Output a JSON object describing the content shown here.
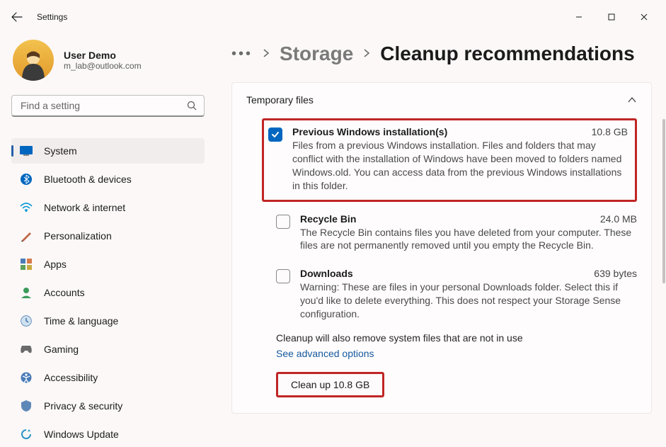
{
  "window": {
    "title": "Settings"
  },
  "user": {
    "name": "User Demo",
    "email": "m_lab@outlook.com"
  },
  "search": {
    "placeholder": "Find a setting"
  },
  "nav": [
    {
      "label": "System"
    },
    {
      "label": "Bluetooth & devices"
    },
    {
      "label": "Network & internet"
    },
    {
      "label": "Personalization"
    },
    {
      "label": "Apps"
    },
    {
      "label": "Accounts"
    },
    {
      "label": "Time & language"
    },
    {
      "label": "Gaming"
    },
    {
      "label": "Accessibility"
    },
    {
      "label": "Privacy & security"
    },
    {
      "label": "Windows Update"
    }
  ],
  "breadcrumb": {
    "parent": "Storage",
    "current": "Cleanup recommendations"
  },
  "panel": {
    "title": "Temporary files",
    "items": [
      {
        "title": "Previous Windows installation(s)",
        "size": "10.8 GB",
        "desc": "Files from a previous Windows installation.  Files and folders that may conflict with the installation of Windows have been moved to folders named Windows.old.  You can access data from the previous Windows installations in this folder.",
        "checked": true
      },
      {
        "title": "Recycle Bin",
        "size": "24.0 MB",
        "desc": "The Recycle Bin contains files you have deleted from your computer. These files are not permanently removed until you empty the Recycle Bin.",
        "checked": false
      },
      {
        "title": "Downloads",
        "size": "639 bytes",
        "desc": "Warning: These are files in your personal Downloads folder. Select this if you'd like to delete everything. This does not respect your Storage Sense configuration.",
        "checked": false
      }
    ],
    "note": "Cleanup will also remove system files that are not in use",
    "advanced_link": "See advanced options",
    "cleanup_button": "Clean up 10.8 GB"
  }
}
